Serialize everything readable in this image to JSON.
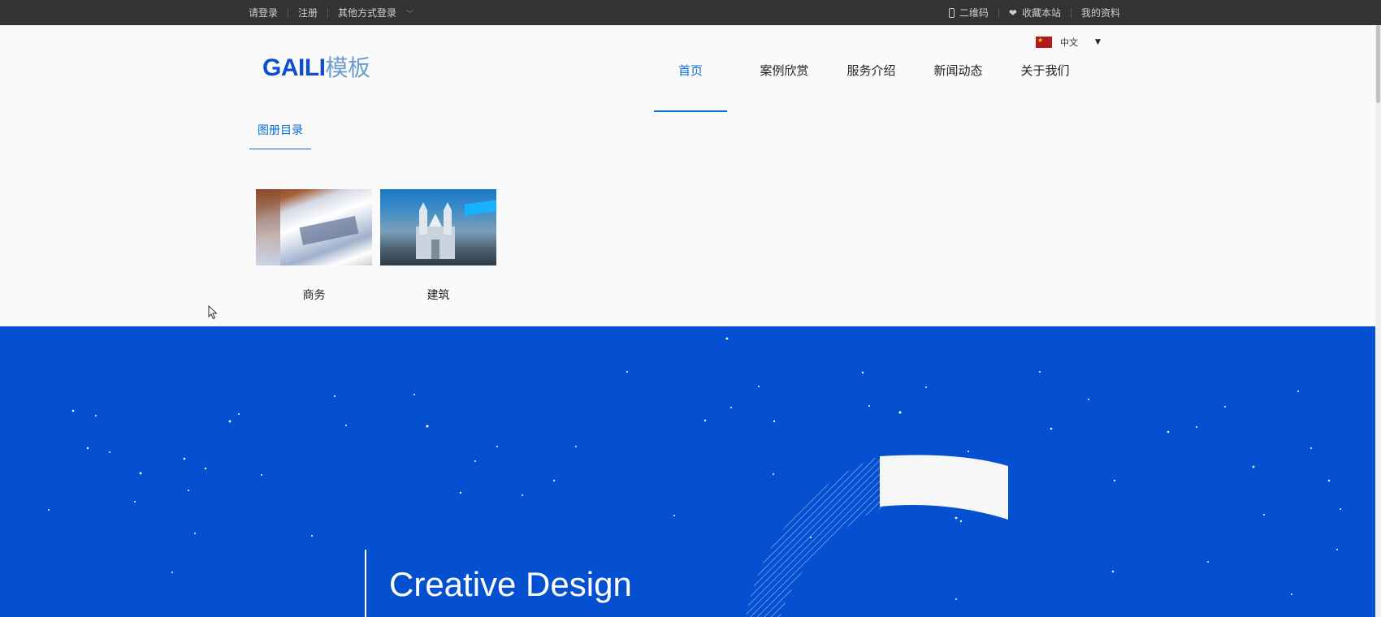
{
  "topbar": {
    "left": [
      {
        "label": "请登录"
      },
      {
        "label": "注册"
      },
      {
        "label": "其他方式登录"
      }
    ],
    "right": [
      {
        "icon": "phone-icon",
        "label": "二维码"
      },
      {
        "icon": "heart-icon",
        "label": "收藏本站"
      },
      {
        "label": "我的资料"
      }
    ]
  },
  "header": {
    "logo_en": "GAILI",
    "logo_cn": "模板",
    "language": "中文",
    "nav": [
      "首页",
      "案例欣赏",
      "服务介绍",
      "新闻动态",
      "关于我们"
    ],
    "active_nav": "首页"
  },
  "album": {
    "tab_label": "图册目录",
    "items": [
      {
        "caption": "商务",
        "image": "business-photo"
      },
      {
        "caption": "建筑",
        "image": "building-photo"
      }
    ]
  },
  "hero": {
    "headline": "Creative Design"
  },
  "colors": {
    "topbar_bg": "#333333",
    "accent": "#0b6bd8",
    "logo_blue": "#0b4fd0",
    "hero_bg": "#0450d0"
  }
}
